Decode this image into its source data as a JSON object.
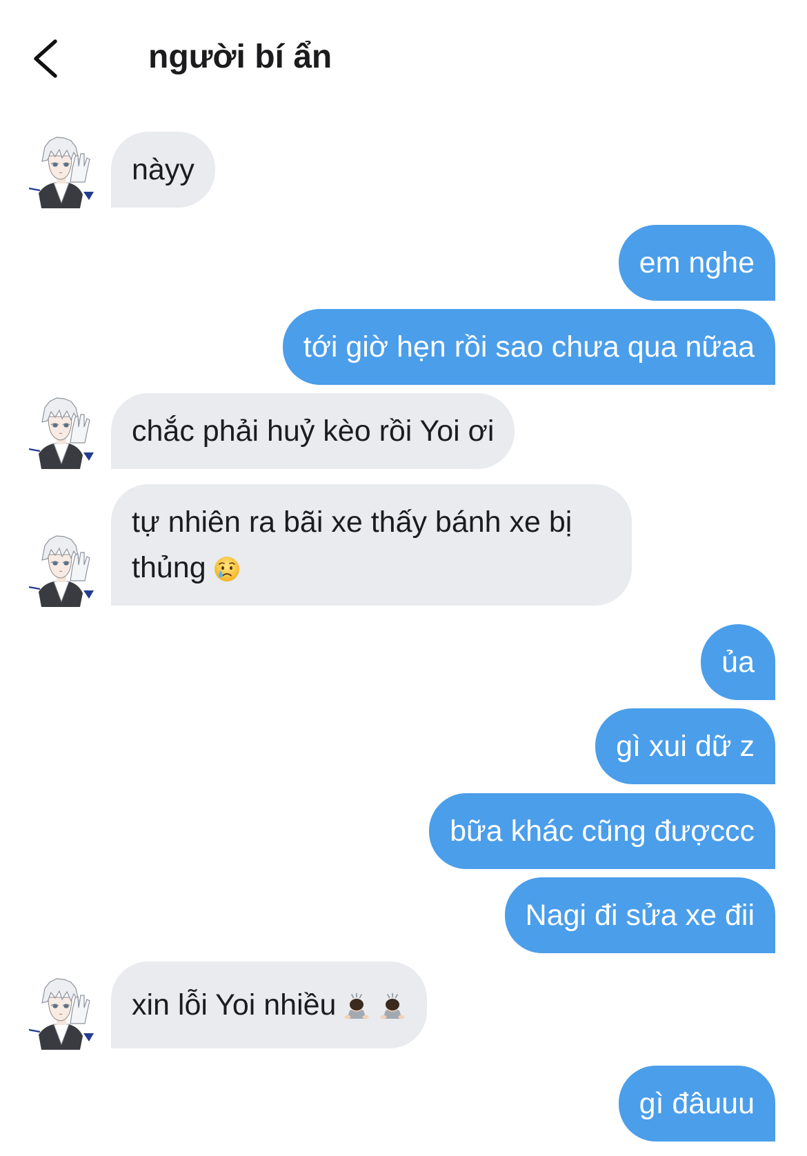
{
  "header": {
    "title": "người bí ẩn",
    "back_icon": "chevron-left-icon"
  },
  "colors": {
    "sent_bubble": "#4B9EEA",
    "received_bubble": "#E9EBEE",
    "sent_text": "#FFFFFF",
    "received_text": "#1C1C1E"
  },
  "avatar": {
    "image": "anime-character-avatar"
  },
  "messages": [
    {
      "sender": "them",
      "text": "nàyy"
    },
    {
      "sender": "me",
      "text": "em nghe"
    },
    {
      "sender": "me",
      "text": "tới giờ hẹn rồi sao chưa qua nữaa"
    },
    {
      "sender": "them",
      "text": "chắc phải huỷ kèo rồi Yoi ơi"
    },
    {
      "sender": "them",
      "text": "tự nhiên ra bãi xe thấy bánh xe bị thủng",
      "emoji": [
        "crying-face"
      ]
    },
    {
      "sender": "me",
      "text": "ủa"
    },
    {
      "sender": "me",
      "text": "gì xui dữ z"
    },
    {
      "sender": "me",
      "text": "bữa khác cũng đượccc"
    },
    {
      "sender": "me",
      "text": "Nagi đi sửa xe đii"
    },
    {
      "sender": "them",
      "text": "xin lỗi Yoi nhiều",
      "emoji": [
        "man-bowing-light-skin-tone",
        "man-bowing-light-skin-tone"
      ]
    },
    {
      "sender": "me",
      "text": "gì đâuuu"
    }
  ]
}
